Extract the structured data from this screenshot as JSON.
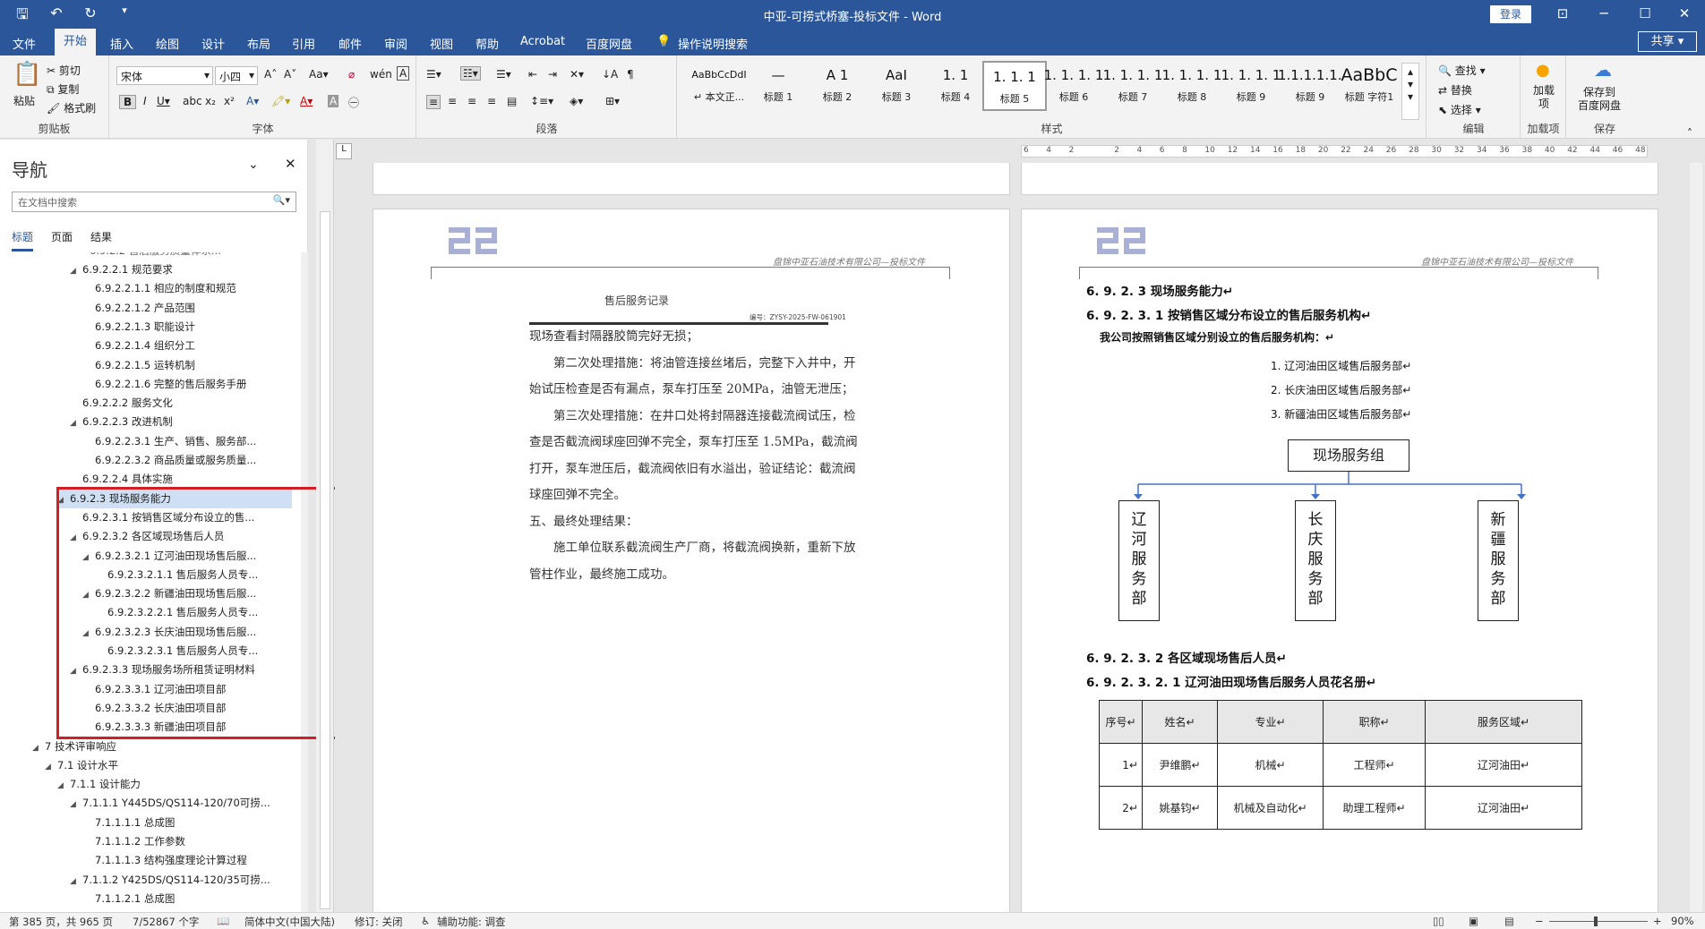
{
  "window": {
    "title": "中亚-可捞式桥塞-投标文件 - Word",
    "login": "登录"
  },
  "tabs": [
    "文件",
    "开始",
    "插入",
    "绘图",
    "设计",
    "布局",
    "引用",
    "邮件",
    "审阅",
    "视图",
    "帮助",
    "Acrobat",
    "百度网盘"
  ],
  "tellme": "操作说明搜索",
  "share": "共享",
  "ribbon": {
    "clipboard": {
      "paste": "粘贴",
      "cut": "剪切",
      "copy": "复制",
      "format_painter": "格式刷",
      "label": "剪贴板"
    },
    "font": {
      "name": "宋体",
      "size": "小四",
      "label": "字体"
    },
    "paragraph": {
      "label": "段落"
    },
    "styles": {
      "label": "样式",
      "items": [
        {
          "preview": "AaBbCcDdI",
          "name": "↵ 本文正..."
        },
        {
          "preview": "—",
          "name": "标题 1"
        },
        {
          "preview": "A 1",
          "name": "标题 2"
        },
        {
          "preview": "AaI",
          "name": "标题 3"
        },
        {
          "preview": "1. 1",
          "name": "标题 4"
        },
        {
          "preview": "1. 1. 1",
          "name": "标题 5"
        },
        {
          "preview": "1. 1. 1. 1",
          "name": "标题 6"
        },
        {
          "preview": "1. 1. 1. 1",
          "name": "标题 7"
        },
        {
          "preview": "1. 1. 1. 1",
          "name": "标题 8"
        },
        {
          "preview": "1. 1. 1. 1",
          "name": "标题 9"
        },
        {
          "preview": "1.1.1.1.1.1.",
          "name": "标题 9"
        },
        {
          "preview": "AaBbC",
          "name": "标题 字符1"
        }
      ]
    },
    "editing": {
      "find": "查找",
      "replace": "替换",
      "select": "选择",
      "label": "编辑"
    },
    "addins": {
      "btn": "加载项",
      "label": "加载项"
    },
    "save": {
      "btn1": "保存到",
      "btn2": "百度网盘",
      "label": "保存"
    }
  },
  "hruler_ticks": [
    "6",
    "4",
    "2",
    "",
    "2",
    "4",
    "6",
    "8",
    "10",
    "12",
    "14",
    "16",
    "18",
    "20",
    "22",
    "24",
    "26",
    "28",
    "30",
    "32",
    "34",
    "36",
    "38",
    "40",
    "42",
    "44",
    "46",
    "48"
  ],
  "nav": {
    "title": "导航",
    "search_placeholder": "在文档中搜索",
    "tabs": [
      "标题",
      "页面",
      "结果"
    ],
    "items": [
      {
        "text": "6.9.2.2.1 规范要求",
        "level": 2,
        "tri": "◢"
      },
      {
        "text": "6.9.2.2.1.1 相应的制度和规范",
        "level": 3,
        "tri": ""
      },
      {
        "text": "6.9.2.2.1.2 产品范围",
        "level": 3,
        "tri": ""
      },
      {
        "text": "6.9.2.2.1.3 职能设计",
        "level": 3,
        "tri": ""
      },
      {
        "text": "6.9.2.2.1.4 组织分工",
        "level": 3,
        "tri": ""
      },
      {
        "text": "6.9.2.2.1.5 运转机制",
        "level": 3,
        "tri": ""
      },
      {
        "text": "6.9.2.2.1.6 完整的售后服务手册",
        "level": 3,
        "tri": ""
      },
      {
        "text": "6.9.2.2.2 服务文化",
        "level": 2,
        "tri": ""
      },
      {
        "text": "6.9.2.2.3 改进机制",
        "level": 2,
        "tri": "◢"
      },
      {
        "text": "6.9.2.2.3.1 生产、销售、服务部...",
        "level": 3,
        "tri": ""
      },
      {
        "text": "6.9.2.2.3.2 商品质量或服务质量...",
        "level": 3,
        "tri": ""
      },
      {
        "text": "6.9.2.2.4 具体实施",
        "level": 2,
        "tri": ""
      },
      {
        "text": "6.9.2.3 现场服务能力",
        "level": 1,
        "tri": "◢"
      },
      {
        "text": "6.9.2.3.1 按销售区域分布设立的售...",
        "level": 2,
        "tri": ""
      },
      {
        "text": "6.9.2.3.2 各区域现场售后人员",
        "level": 2,
        "tri": "◢"
      },
      {
        "text": "6.9.2.3.2.1 辽河油田现场售后服...",
        "level": 3,
        "tri": "◢"
      },
      {
        "text": "6.9.2.3.2.1.1 售后服务人员专...",
        "level": 4,
        "tri": ""
      },
      {
        "text": "6.9.2.3.2.2 新疆油田现场售后服...",
        "level": 3,
        "tri": "◢"
      },
      {
        "text": "6.9.2.3.2.2.1 售后服务人员专...",
        "level": 4,
        "tri": ""
      },
      {
        "text": "6.9.2.3.2.3 长庆油田现场售后服...",
        "level": 3,
        "tri": "◢"
      },
      {
        "text": "6.9.2.3.2.3.1 售后服务人员专...",
        "level": 4,
        "tri": ""
      },
      {
        "text": "6.9.2.3.3 现场服务场所租赁证明材料",
        "level": 2,
        "tri": "◢"
      },
      {
        "text": "6.9.2.3.3.1 辽河油田项目部",
        "level": 3,
        "tri": ""
      },
      {
        "text": "6.9.2.3.3.2 长庆油田项目部",
        "level": 3,
        "tri": ""
      },
      {
        "text": "6.9.2.3.3.3 新疆油田项目部",
        "level": 3,
        "tri": ""
      },
      {
        "text": "7 技术评审响应",
        "level": -1,
        "tri": "◢"
      },
      {
        "text": "7.1 设计水平",
        "level": 0,
        "tri": "◢"
      },
      {
        "text": "7.1.1 设计能力",
        "level": 1,
        "tri": "◢"
      },
      {
        "text": "7.1.1.1 Y445DS/QS114-120/70可捞...",
        "level": 2,
        "tri": "◢"
      },
      {
        "text": "7.1.1.1.1 总成图",
        "level": 3,
        "tri": ""
      },
      {
        "text": "7.1.1.1.2 工作参数",
        "level": 3,
        "tri": ""
      },
      {
        "text": "7.1.1.1.3 结构强度理论计算过程",
        "level": 3,
        "tri": ""
      },
      {
        "text": "7.1.1.2 Y425DS/QS114-120/35可捞...",
        "level": 2,
        "tri": "◢"
      },
      {
        "text": "7.1.1.2.1 总成图",
        "level": 3,
        "tri": ""
      }
    ]
  },
  "page_left": {
    "header": "盘锦中亚石油技术有限公司—投标文件",
    "record_title": "售后服务记录",
    "record_no": "编号：ZYSY-2025-FW-061901",
    "lines": [
      "现场查看封隔器胶筒完好无损；",
      "　　第二次处理措施：将油管连接丝堵后，完整下入井中，开",
      "始试压检查是否有漏点，泵车打压至 20MPa，油管无泄压；",
      "　　第三次处理措施：在井口处将封隔器连接截流阀试压，检",
      "查是否截流阀球座回弹不完全，泵车打压至 1.5MPa，截流阀",
      "打开，泵车泄压后，截流阀依旧有水溢出，验证结论：截流阀",
      "球座回弹不完全。",
      "五、最终处理结果：",
      "　　施工单位联系截流阀生产厂商，将截流阀换新，重新下放",
      "管柱作业，最终施工成功。"
    ]
  },
  "page_right": {
    "header": "盘锦中亚石油技术有限公司—投标文件",
    "h1": "6. 9. 2. 3 现场服务能力↵",
    "h2": "6. 9. 2. 3. 1 按销售区域分布设立的售后服务机构↵",
    "intro": "我公司按照销售区域分别设立的售后服务机构：↵",
    "list": [
      "1. 辽河油田区域售后服务部↵",
      "2. 长庆油田区域售后服务部↵",
      "3. 新疆油田区域售后服务部↵"
    ],
    "org_top": "现场服务组",
    "org_children": [
      "辽河服务部",
      "长庆服务部",
      "新疆服务部"
    ],
    "h3": "6. 9. 2. 3. 2 各区域现场售后人员↵",
    "h4": "6. 9. 2. 3. 2. 1 辽河油田现场售后服务人员花名册↵",
    "table_head": [
      "序号↵",
      "姓名↵",
      "专业↵",
      "职称↵",
      "服务区域↵"
    ],
    "table_rows": [
      [
        "1↵",
        "尹维鹏↵",
        "机械↵",
        "工程师↵",
        "辽河油田↵"
      ],
      [
        "2↵",
        "姚基钧↵",
        "机械及自动化↵",
        "助理工程师↵",
        "辽河油田↵"
      ]
    ]
  },
  "status": {
    "page": "第 385 页，共 965 页",
    "words": "7/52867 个字",
    "lang": "简体中文(中国大陆)",
    "track": "修订: 关闭",
    "access": "辅助功能: 调查",
    "zoom": "90%"
  }
}
